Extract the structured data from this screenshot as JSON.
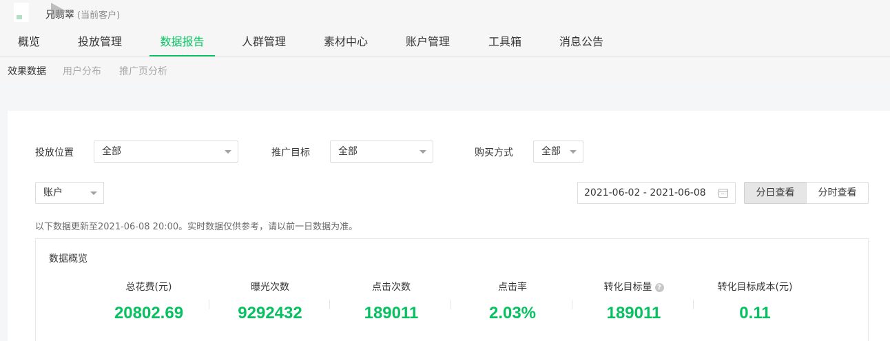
{
  "header": {
    "account_name": "兄翡翠",
    "account_tag": "(当前客户)"
  },
  "mainnav": {
    "tabs": [
      {
        "label": "概览"
      },
      {
        "label": "投放管理"
      },
      {
        "label": "数据报告"
      },
      {
        "label": "人群管理"
      },
      {
        "label": "素材中心"
      },
      {
        "label": "账户管理"
      },
      {
        "label": "工具箱"
      },
      {
        "label": "消息公告"
      }
    ],
    "active": "数据报告"
  },
  "subnav": {
    "tabs": [
      {
        "label": "效果数据"
      },
      {
        "label": "用户分布"
      },
      {
        "label": "推广页分析"
      }
    ],
    "active": "效果数据"
  },
  "filters": {
    "placement_label": "投放位置",
    "placement_value": "全部",
    "goal_label": "推广目标",
    "goal_value": "全部",
    "purchase_label": "购买方式",
    "purchase_value": "全部",
    "dimension_value": "账户",
    "date_range": "2021-06-02 - 2021-06-08",
    "view_daily": "分日查看",
    "view_hourly": "分时查看"
  },
  "notice": "以下数据更新至2021-06-08 20:00。实时数据仅供参考，请以前一日数据为准。",
  "overview": {
    "title": "数据概览",
    "metrics": [
      {
        "label": "总花费(元)",
        "value": "20802.69"
      },
      {
        "label": "曝光次数",
        "value": "9292432"
      },
      {
        "label": "点击次数",
        "value": "189011"
      },
      {
        "label": "点击率",
        "value": "2.03%"
      },
      {
        "label": "转化目标量",
        "value": "189011"
      },
      {
        "label": "转化目标成本(元)",
        "value": "0.11"
      }
    ],
    "help_glyph": "?"
  },
  "colors": {
    "accent": "#07c160",
    "background": "#f5f6f7"
  }
}
